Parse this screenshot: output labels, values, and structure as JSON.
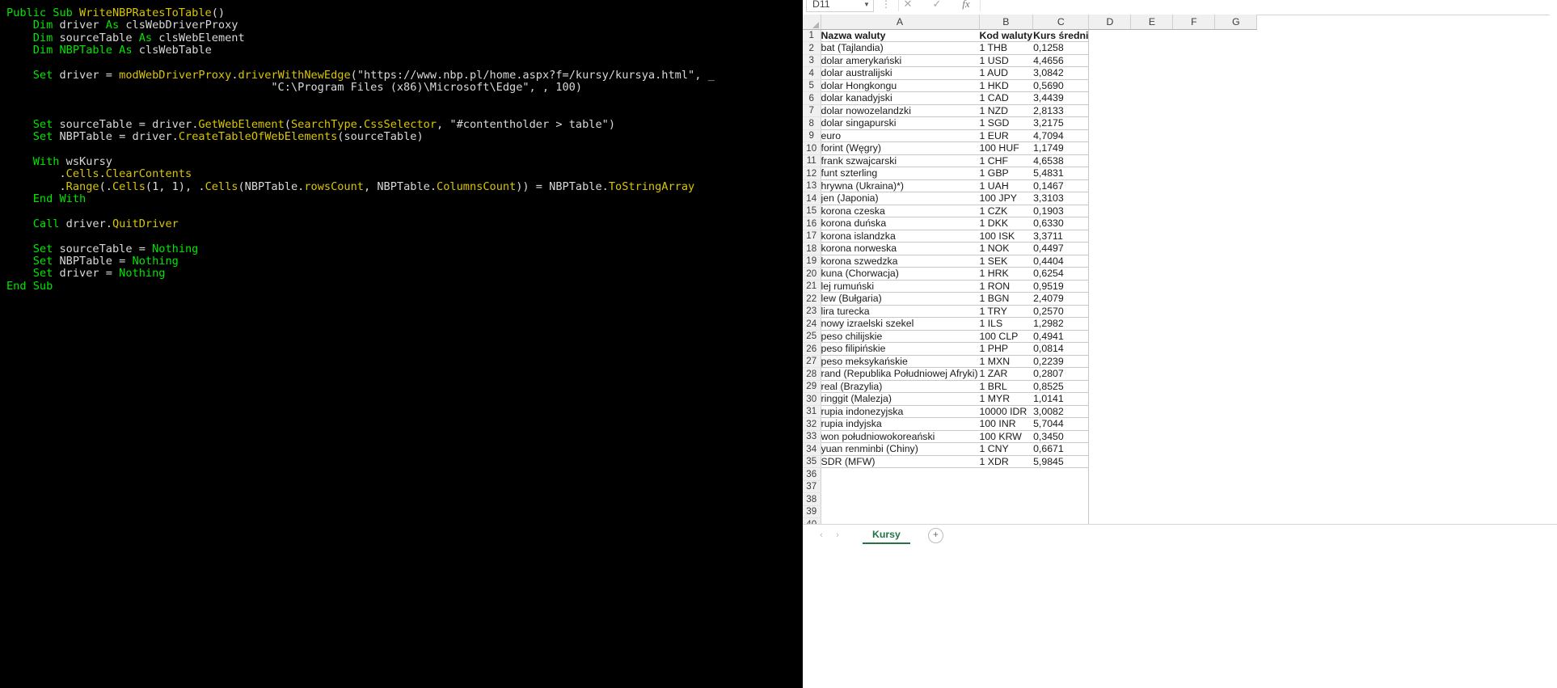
{
  "code_editor": {
    "language": "VBA",
    "lines": [
      [
        {
          "t": "Public ",
          "c": "kw"
        },
        {
          "t": "Sub ",
          "c": "kw"
        },
        {
          "t": "WriteNBPRatesToTable",
          "c": "fn"
        },
        {
          "t": "()",
          "c": "id"
        }
      ],
      [
        {
          "t": "    ",
          "c": "id"
        },
        {
          "t": "Dim ",
          "c": "kw"
        },
        {
          "t": "driver ",
          "c": "id"
        },
        {
          "t": "As ",
          "c": "kw"
        },
        {
          "t": "clsWebDriverProxy",
          "c": "id"
        }
      ],
      [
        {
          "t": "    ",
          "c": "id"
        },
        {
          "t": "Dim ",
          "c": "kw"
        },
        {
          "t": "sourceTable ",
          "c": "id"
        },
        {
          "t": "As ",
          "c": "kw"
        },
        {
          "t": "clsWebElement",
          "c": "id"
        }
      ],
      [
        {
          "t": "    ",
          "c": "id"
        },
        {
          "t": "Dim ",
          "c": "kw"
        },
        {
          "t": "NBPTable ",
          "c": "kw"
        },
        {
          "t": "As ",
          "c": "kw"
        },
        {
          "t": "clsWebTable",
          "c": "id"
        }
      ],
      [],
      [
        {
          "t": "    ",
          "c": "id"
        },
        {
          "t": "Set ",
          "c": "kw"
        },
        {
          "t": "driver = ",
          "c": "id"
        },
        {
          "t": "modWebDriverProxy",
          "c": "fn"
        },
        {
          "t": ".",
          "c": "id"
        },
        {
          "t": "driverWithNewEdge",
          "c": "fn"
        },
        {
          "t": "(",
          "c": "id"
        },
        {
          "t": "\"https://www.nbp.pl/home.aspx?f=/kursy/kursya.html\", _",
          "c": "str"
        }
      ],
      [
        {
          "t": "                                        ",
          "c": "id"
        },
        {
          "t": "\"C:\\Program Files (x86)\\Microsoft\\Edge\", , 100)",
          "c": "str"
        }
      ],
      [],
      [],
      [
        {
          "t": "    ",
          "c": "id"
        },
        {
          "t": "Set ",
          "c": "kw"
        },
        {
          "t": "sourceTable = ",
          "c": "id"
        },
        {
          "t": "driver",
          "c": "id"
        },
        {
          "t": ".",
          "c": "id"
        },
        {
          "t": "GetWebElement",
          "c": "fn"
        },
        {
          "t": "(",
          "c": "id"
        },
        {
          "t": "SearchType",
          "c": "fn"
        },
        {
          "t": ".",
          "c": "id"
        },
        {
          "t": "CssSelector",
          "c": "fn"
        },
        {
          "t": ", \"#contentholder > table\")",
          "c": "id"
        }
      ],
      [
        {
          "t": "    ",
          "c": "id"
        },
        {
          "t": "Set ",
          "c": "kw"
        },
        {
          "t": "NBPTable = ",
          "c": "id"
        },
        {
          "t": "driver",
          "c": "id"
        },
        {
          "t": ".",
          "c": "id"
        },
        {
          "t": "CreateTableOfWebElements",
          "c": "fn"
        },
        {
          "t": "(sourceTable)",
          "c": "id"
        }
      ],
      [],
      [
        {
          "t": "    ",
          "c": "id"
        },
        {
          "t": "With ",
          "c": "kw"
        },
        {
          "t": "wsKursy",
          "c": "id"
        }
      ],
      [
        {
          "t": "        .",
          "c": "id"
        },
        {
          "t": "Cells",
          "c": "fn"
        },
        {
          "t": ".",
          "c": "id"
        },
        {
          "t": "ClearContents",
          "c": "fn"
        }
      ],
      [
        {
          "t": "        .",
          "c": "id"
        },
        {
          "t": "Range",
          "c": "fn"
        },
        {
          "t": "(.",
          "c": "id"
        },
        {
          "t": "Cells",
          "c": "fn"
        },
        {
          "t": "(1, 1), .",
          "c": "id"
        },
        {
          "t": "Cells",
          "c": "fn"
        },
        {
          "t": "(NBPTable.",
          "c": "id"
        },
        {
          "t": "rowsCount",
          "c": "fn"
        },
        {
          "t": ", NBPTable.",
          "c": "id"
        },
        {
          "t": "ColumnsCount",
          "c": "fn"
        },
        {
          "t": ")) = NBPTable.",
          "c": "id"
        },
        {
          "t": "ToStringArray",
          "c": "fn"
        }
      ],
      [
        {
          "t": "    ",
          "c": "id"
        },
        {
          "t": "End With",
          "c": "kw"
        }
      ],
      [],
      [
        {
          "t": "    ",
          "c": "id"
        },
        {
          "t": "Call ",
          "c": "kw"
        },
        {
          "t": "driver",
          "c": "id"
        },
        {
          "t": ".",
          "c": "id"
        },
        {
          "t": "QuitDriver",
          "c": "fn"
        }
      ],
      [],
      [
        {
          "t": "    ",
          "c": "id"
        },
        {
          "t": "Set ",
          "c": "kw"
        },
        {
          "t": "sourceTable = ",
          "c": "id"
        },
        {
          "t": "Nothing",
          "c": "kw"
        }
      ],
      [
        {
          "t": "    ",
          "c": "id"
        },
        {
          "t": "Set ",
          "c": "kw"
        },
        {
          "t": "NBPTable = ",
          "c": "id"
        },
        {
          "t": "Nothing",
          "c": "kw"
        }
      ],
      [
        {
          "t": "    ",
          "c": "id"
        },
        {
          "t": "Set ",
          "c": "kw"
        },
        {
          "t": "driver = ",
          "c": "id"
        },
        {
          "t": "Nothing",
          "c": "kw"
        }
      ],
      [
        {
          "t": "End ",
          "c": "kw"
        },
        {
          "t": "Sub",
          "c": "kw"
        }
      ]
    ],
    "colors": {
      "background": "#000000",
      "keyword": "#00e600",
      "identifier": "#d9d9d9",
      "member": "#d9c500"
    }
  },
  "spreadsheet": {
    "name_box_value": "D11",
    "formula_bar_value": "",
    "formula_bar_icons": [
      "more-options-icon",
      "cancel-icon",
      "confirm-icon",
      "insert-function-icon"
    ],
    "column_headers": [
      "A",
      "B",
      "C",
      "D",
      "E",
      "F",
      "G"
    ],
    "columns": {
      "A": "Nazwa waluty",
      "B": "Kod waluty",
      "C": "Kurs średni"
    },
    "header_row": [
      "Nazwa waluty",
      "Kod waluty",
      "Kurs średni"
    ],
    "rows": [
      {
        "n": 1,
        "a": "Nazwa waluty",
        "b": "Kod waluty",
        "c": "Kurs średni",
        "header": true
      },
      {
        "n": 2,
        "a": "bat (Tajlandia)",
        "b": "1 THB",
        "c": "0,1258"
      },
      {
        "n": 3,
        "a": "dolar amerykański",
        "b": "1 USD",
        "c": "4,4656"
      },
      {
        "n": 4,
        "a": "dolar australijski",
        "b": "1 AUD",
        "c": "3,0842"
      },
      {
        "n": 5,
        "a": "dolar Hongkongu",
        "b": "1 HKD",
        "c": "0,5690"
      },
      {
        "n": 6,
        "a": "dolar kanadyjski",
        "b": "1 CAD",
        "c": "3,4439"
      },
      {
        "n": 7,
        "a": "dolar nowozelandzki",
        "b": "1 NZD",
        "c": "2,8133"
      },
      {
        "n": 8,
        "a": "dolar singapurski",
        "b": "1 SGD",
        "c": "3,2175"
      },
      {
        "n": 9,
        "a": "euro",
        "b": "1 EUR",
        "c": "4,7094"
      },
      {
        "n": 10,
        "a": "forint (Węgry)",
        "b": "100 HUF",
        "c": "1,1749"
      },
      {
        "n": 11,
        "a": "frank szwajcarski",
        "b": "1 CHF",
        "c": "4,6538"
      },
      {
        "n": 12,
        "a": "funt szterling",
        "b": "1 GBP",
        "c": "5,4831"
      },
      {
        "n": 13,
        "a": "hrywna (Ukraina)*)",
        "b": "1 UAH",
        "c": "0,1467"
      },
      {
        "n": 14,
        "a": "jen (Japonia)",
        "b": "100 JPY",
        "c": "3,3103"
      },
      {
        "n": 15,
        "a": "korona czeska",
        "b": "1 CZK",
        "c": "0,1903"
      },
      {
        "n": 16,
        "a": "korona duńska",
        "b": "1 DKK",
        "c": "0,6330"
      },
      {
        "n": 17,
        "a": "korona islandzka",
        "b": "100 ISK",
        "c": "3,3711"
      },
      {
        "n": 18,
        "a": "korona norweska",
        "b": "1 NOK",
        "c": "0,4497"
      },
      {
        "n": 19,
        "a": "korona szwedzka",
        "b": "1 SEK",
        "c": "0,4404"
      },
      {
        "n": 20,
        "a": "kuna (Chorwacja)",
        "b": "1 HRK",
        "c": "0,6254"
      },
      {
        "n": 21,
        "a": "lej rumuński",
        "b": "1 RON",
        "c": "0,9519"
      },
      {
        "n": 22,
        "a": "lew (Bułgaria)",
        "b": "1 BGN",
        "c": "2,4079"
      },
      {
        "n": 23,
        "a": "lira turecka",
        "b": "1 TRY",
        "c": "0,2570"
      },
      {
        "n": 24,
        "a": "nowy izraelski szekel",
        "b": "1 ILS",
        "c": "1,2982"
      },
      {
        "n": 25,
        "a": "peso chilijskie",
        "b": "100 CLP",
        "c": "0,4941"
      },
      {
        "n": 26,
        "a": "peso filipińskie",
        "b": "1 PHP",
        "c": "0,0814"
      },
      {
        "n": 27,
        "a": "peso meksykańskie",
        "b": "1 MXN",
        "c": "0,2239"
      },
      {
        "n": 28,
        "a": "rand (Republika Południowej Afryki)",
        "b": "1 ZAR",
        "c": "0,2807"
      },
      {
        "n": 29,
        "a": "real (Brazylia)",
        "b": "1 BRL",
        "c": "0,8525"
      },
      {
        "n": 30,
        "a": "ringgit (Malezja)",
        "b": "1 MYR",
        "c": "1,0141"
      },
      {
        "n": 31,
        "a": "rupia indonezyjska",
        "b": "10000 IDR",
        "c": "3,0082"
      },
      {
        "n": 32,
        "a": "rupia indyjska",
        "b": "100 INR",
        "c": "5,7044"
      },
      {
        "n": 33,
        "a": "won południowokoreański",
        "b": "100 KRW",
        "c": "0,3450"
      },
      {
        "n": 34,
        "a": "yuan renminbi (Chiny)",
        "b": "1 CNY",
        "c": "0,6671"
      },
      {
        "n": 35,
        "a": "SDR (MFW)",
        "b": "1 XDR",
        "c": "5,9845"
      },
      {
        "n": 36,
        "a": "",
        "b": "",
        "c": ""
      },
      {
        "n": 37,
        "a": "",
        "b": "",
        "c": ""
      },
      {
        "n": 38,
        "a": "",
        "b": "",
        "c": ""
      },
      {
        "n": 39,
        "a": "",
        "b": "",
        "c": ""
      },
      {
        "n": 40,
        "a": "",
        "b": "",
        "c": ""
      }
    ],
    "sheet_tabs": [
      {
        "label": "Kursy",
        "active": true
      }
    ],
    "tab_nav": {
      "prev": "‹",
      "next": "›",
      "add": "+"
    },
    "accent_color": "#217346"
  }
}
